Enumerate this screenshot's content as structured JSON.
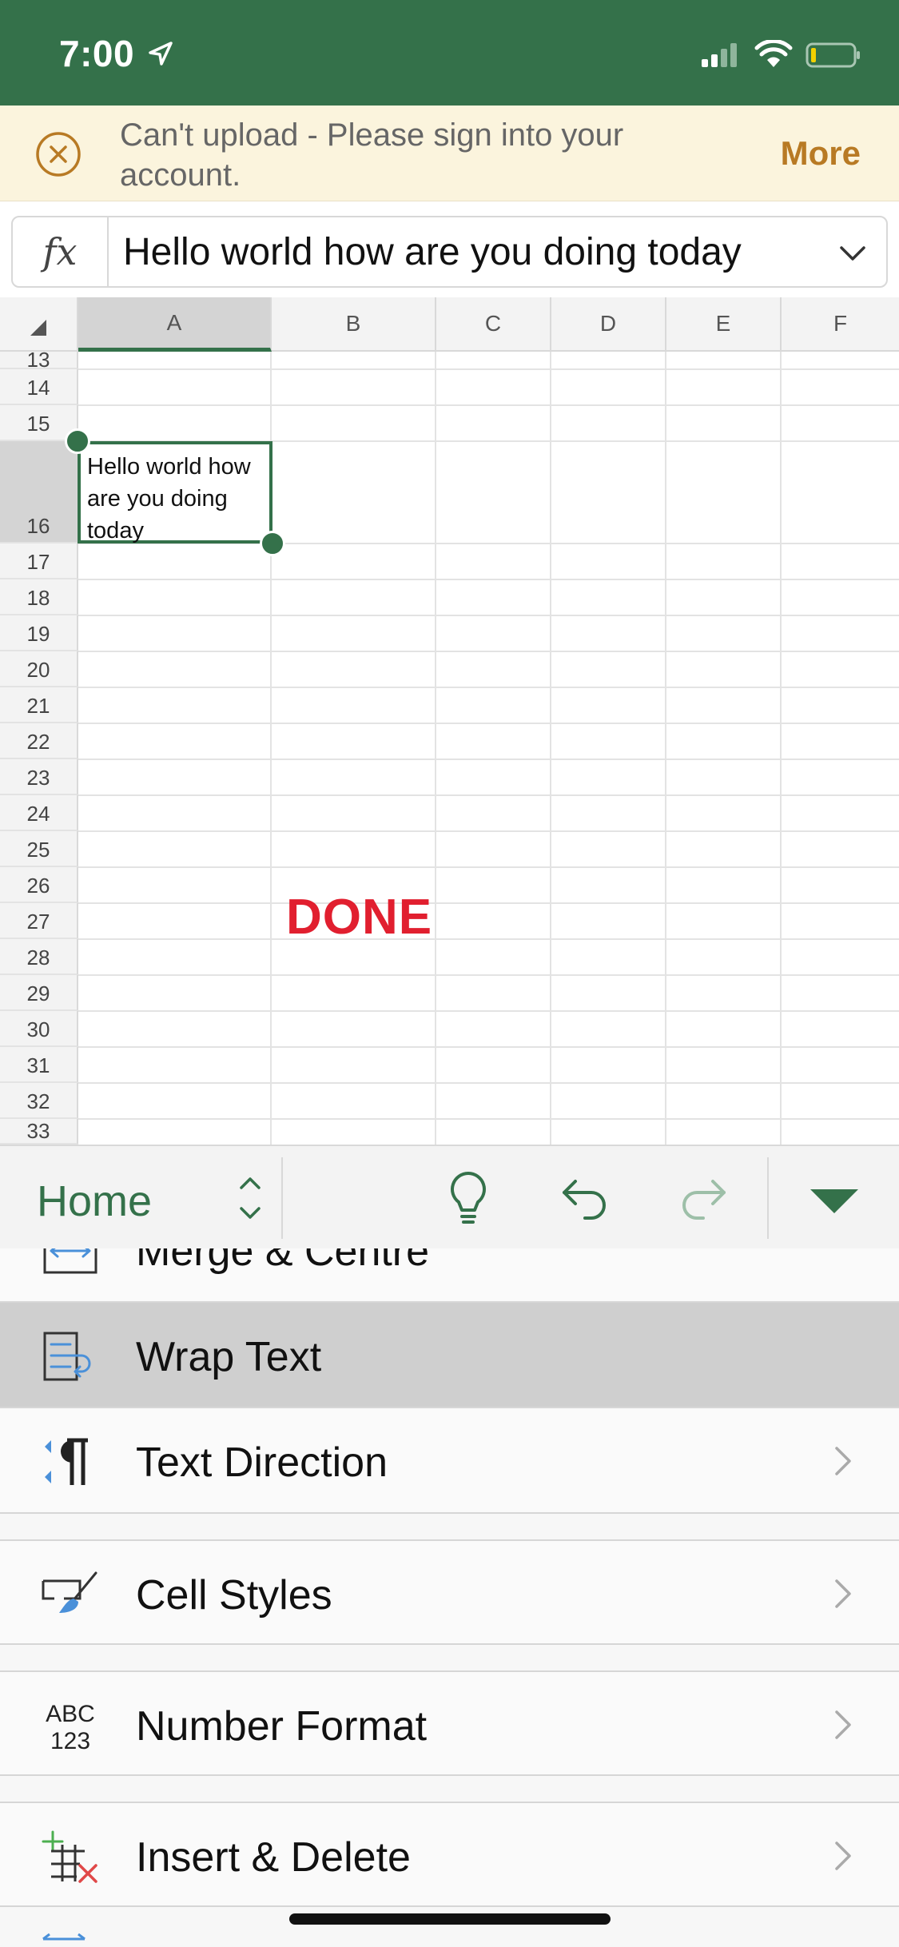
{
  "status_bar": {
    "time": "7:00"
  },
  "banner": {
    "message": "Can't upload - Please sign into your account.",
    "more_label": "More"
  },
  "formula_bar": {
    "fx_label": "fx",
    "content": "Hello world how are you doing today"
  },
  "sheet": {
    "columns": [
      "A",
      "B",
      "C",
      "D",
      "E",
      "F"
    ],
    "selected_column": "A",
    "rows": [
      "13",
      "14",
      "15",
      "16",
      "17",
      "18",
      "19",
      "20",
      "21",
      "22",
      "23",
      "24",
      "25",
      "26",
      "27",
      "28",
      "29",
      "30",
      "31",
      "32",
      "33"
    ],
    "selected_row": "16",
    "selected_cell": "A16",
    "selected_cell_text": "Hello world how are you doing today",
    "overlay_text": "DONE",
    "overlay_color": "#e11f2f"
  },
  "toolbar": {
    "tab_label": "Home",
    "icons": [
      "tab-switch-icon",
      "lightbulb-icon",
      "undo-icon",
      "redo-icon",
      "collapse-ribbon-icon"
    ]
  },
  "menu": {
    "items": [
      {
        "label": "Merge & Centre",
        "icon": "merge-centre-icon"
      },
      {
        "label": "Wrap Text",
        "icon": "wrap-text-icon",
        "selected": true
      },
      {
        "label": "Text Direction",
        "icon": "text-direction-icon"
      },
      {
        "label": "Cell Styles",
        "icon": "cell-styles-icon"
      },
      {
        "label": "Number Format",
        "icon": "number-format-icon",
        "icon_text_top": "ABC",
        "icon_text_bottom": "123"
      },
      {
        "label": "Insert & Delete",
        "icon": "insert-delete-icon"
      }
    ]
  },
  "colors": {
    "brand_green": "#34714a",
    "banner_bg": "#fbf4dd",
    "banner_accent": "#b87a24",
    "icon_blue": "#4a90d9",
    "delete_red": "#e04848"
  }
}
